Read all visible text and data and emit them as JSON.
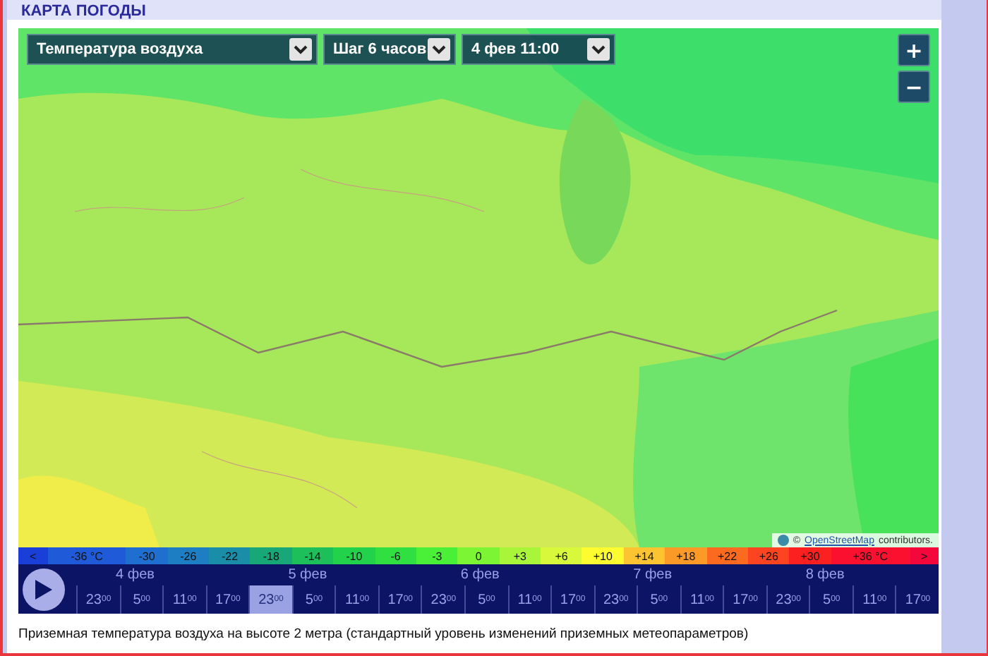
{
  "header": {
    "title": "КАРТА ПОГОДЫ"
  },
  "map": {
    "selectors": [
      {
        "value": "Температура воздуха"
      },
      {
        "value": "Шаг 6 часов"
      },
      {
        "value": "4 фев 11:00"
      }
    ],
    "zoom_buttons": [
      "+",
      "−"
    ],
    "attribution": {
      "mark": "©",
      "link": "OpenStreetMap",
      "text": "contributors."
    }
  },
  "legend": [
    {
      "label": "<",
      "color": "#1a3fd8"
    },
    {
      "label": "-36 °C",
      "color": "#1f5ad8"
    },
    {
      "label": "-30",
      "color": "#1e6fd0"
    },
    {
      "label": "-26",
      "color": "#1d7ec4"
    },
    {
      "label": "-22",
      "color": "#1a8ea8"
    },
    {
      "label": "-18",
      "color": "#18a878"
    },
    {
      "label": "-14",
      "color": "#1cbf5a"
    },
    {
      "label": "-10",
      "color": "#22d24a"
    },
    {
      "label": "-6",
      "color": "#30e040"
    },
    {
      "label": "-3",
      "color": "#4af038"
    },
    {
      "label": "0",
      "color": "#7cf534"
    },
    {
      "label": "+3",
      "color": "#a8f53a"
    },
    {
      "label": "+6",
      "color": "#d8f83c"
    },
    {
      "label": "+10",
      "color": "#fcfc30"
    },
    {
      "label": "+14",
      "color": "#fcc430"
    },
    {
      "label": "+18",
      "color": "#fc9a28"
    },
    {
      "label": "+22",
      "color": "#fc6a20"
    },
    {
      "label": "+26",
      "color": "#fc4420"
    },
    {
      "label": "+30",
      "color": "#fc2020"
    },
    {
      "label": "+36 °C",
      "color": "#fc1030"
    },
    {
      "label": ">",
      "color": "#f4083c"
    }
  ],
  "timeline": {
    "days": [
      {
        "label": "4 фев",
        "times": [
          {
            "label": "23$^{00}$",
            "selected": false
          },
          {
            "label": "5$^{00}$",
            "selected": false
          },
          {
            "label": "11$^{00}$",
            "selected": false
          },
          {
            "label": "17$^{00}$",
            "selected": false
          }
        ]
      },
      {
        "label": "5 фев",
        "times": [
          {
            "label": "23$^{00}$",
            "selected": true
          },
          {
            "label": "5$^{00}$",
            "selected": false
          },
          {
            "label": "11$^{00}$",
            "selected": false
          },
          {
            "label": "17$^{00}$",
            "selected": false
          }
        ]
      },
      {
        "label": "6 фев",
        "times": [
          {
            "label": "23$^{00}$",
            "selected": false
          },
          {
            "label": "5$^{00}$",
            "selected": false
          },
          {
            "label": "11$^{00}$",
            "selected": false
          },
          {
            "label": "17$^{00}$",
            "selected": false
          }
        ]
      },
      {
        "label": "7 фев",
        "times": [
          {
            "label": "23$^{00}$",
            "selected": false
          },
          {
            "label": "5$^{00}$",
            "selected": false
          },
          {
            "label": "11$^{00}$",
            "selected": false
          },
          {
            "label": "17$^{00}$",
            "selected": false
          }
        ]
      },
      {
        "label": "8 фев",
        "times": [
          {
            "label": "23$^{00}$",
            "selected": false
          },
          {
            "label": "5$^{00}$",
            "selected": false
          },
          {
            "label": "11$^{00}$",
            "selected": false
          },
          {
            "label": "17$^{00}$",
            "selected": false
          }
        ]
      }
    ]
  },
  "caption": "Приземная температура воздуха на высоте 2 метра (стандартный уровень изменений приземных метеопараметров)"
}
